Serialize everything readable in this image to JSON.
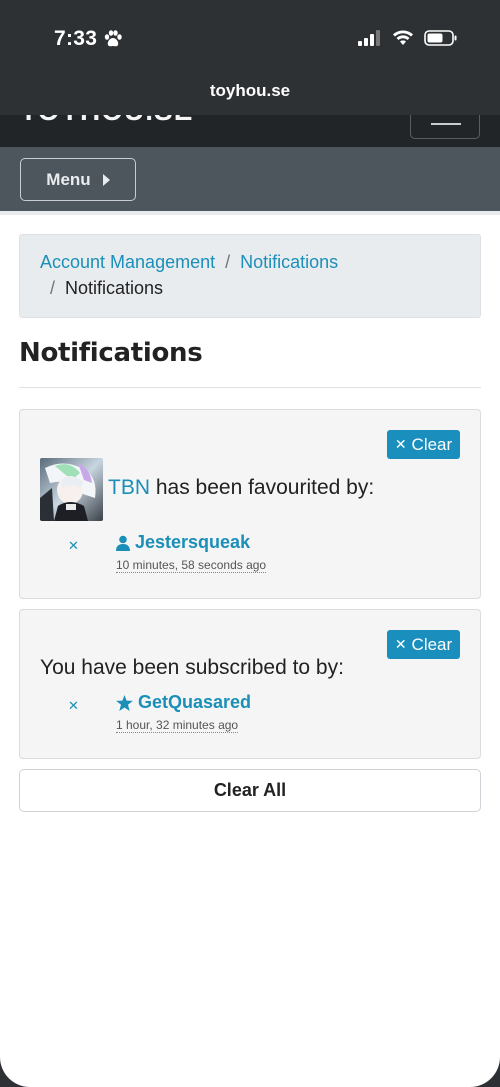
{
  "status_bar": {
    "time": "7:33"
  },
  "browser": {
    "url": "toyhou.se"
  },
  "site": {
    "logo": "TOYHOU.SE",
    "menu_label": "Menu"
  },
  "breadcrumb": {
    "items": [
      "Account Management",
      "Notifications"
    ],
    "current": "Notifications",
    "separator": "/"
  },
  "page_title": "Notifications",
  "notifications": [
    {
      "clear_label": "Clear",
      "subject": "TBN",
      "text": " has been favourited by:",
      "user": "Jestersqueak",
      "time_ago": "10 minutes, 58 seconds ago",
      "user_icon": "user-icon"
    },
    {
      "clear_label": "Clear",
      "text": "You have been subscribed to by:",
      "user": "GetQuasared",
      "time_ago": "1 hour, 32 minutes ago",
      "user_icon": "star-icon"
    }
  ],
  "clear_all_label": "Clear All",
  "colors": {
    "link": "#1b8fb8",
    "clear_button": "#1a8fbd",
    "header": "#2e3134",
    "menu_bar": "#4d555d"
  }
}
